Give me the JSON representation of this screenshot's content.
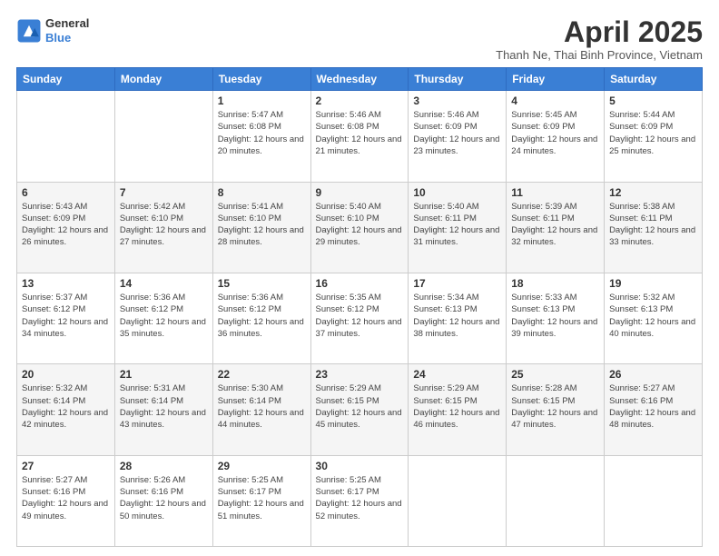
{
  "header": {
    "logo_line1": "General",
    "logo_line2": "Blue",
    "title": "April 2025",
    "subtitle": "Thanh Ne, Thai Binh Province, Vietnam"
  },
  "days_of_week": [
    "Sunday",
    "Monday",
    "Tuesday",
    "Wednesday",
    "Thursday",
    "Friday",
    "Saturday"
  ],
  "weeks": [
    [
      {
        "num": "",
        "sunrise": "",
        "sunset": "",
        "daylight": ""
      },
      {
        "num": "",
        "sunrise": "",
        "sunset": "",
        "daylight": ""
      },
      {
        "num": "1",
        "sunrise": "Sunrise: 5:47 AM",
        "sunset": "Sunset: 6:08 PM",
        "daylight": "Daylight: 12 hours and 20 minutes."
      },
      {
        "num": "2",
        "sunrise": "Sunrise: 5:46 AM",
        "sunset": "Sunset: 6:08 PM",
        "daylight": "Daylight: 12 hours and 21 minutes."
      },
      {
        "num": "3",
        "sunrise": "Sunrise: 5:46 AM",
        "sunset": "Sunset: 6:09 PM",
        "daylight": "Daylight: 12 hours and 23 minutes."
      },
      {
        "num": "4",
        "sunrise": "Sunrise: 5:45 AM",
        "sunset": "Sunset: 6:09 PM",
        "daylight": "Daylight: 12 hours and 24 minutes."
      },
      {
        "num": "5",
        "sunrise": "Sunrise: 5:44 AM",
        "sunset": "Sunset: 6:09 PM",
        "daylight": "Daylight: 12 hours and 25 minutes."
      }
    ],
    [
      {
        "num": "6",
        "sunrise": "Sunrise: 5:43 AM",
        "sunset": "Sunset: 6:09 PM",
        "daylight": "Daylight: 12 hours and 26 minutes."
      },
      {
        "num": "7",
        "sunrise": "Sunrise: 5:42 AM",
        "sunset": "Sunset: 6:10 PM",
        "daylight": "Daylight: 12 hours and 27 minutes."
      },
      {
        "num": "8",
        "sunrise": "Sunrise: 5:41 AM",
        "sunset": "Sunset: 6:10 PM",
        "daylight": "Daylight: 12 hours and 28 minutes."
      },
      {
        "num": "9",
        "sunrise": "Sunrise: 5:40 AM",
        "sunset": "Sunset: 6:10 PM",
        "daylight": "Daylight: 12 hours and 29 minutes."
      },
      {
        "num": "10",
        "sunrise": "Sunrise: 5:40 AM",
        "sunset": "Sunset: 6:11 PM",
        "daylight": "Daylight: 12 hours and 31 minutes."
      },
      {
        "num": "11",
        "sunrise": "Sunrise: 5:39 AM",
        "sunset": "Sunset: 6:11 PM",
        "daylight": "Daylight: 12 hours and 32 minutes."
      },
      {
        "num": "12",
        "sunrise": "Sunrise: 5:38 AM",
        "sunset": "Sunset: 6:11 PM",
        "daylight": "Daylight: 12 hours and 33 minutes."
      }
    ],
    [
      {
        "num": "13",
        "sunrise": "Sunrise: 5:37 AM",
        "sunset": "Sunset: 6:12 PM",
        "daylight": "Daylight: 12 hours and 34 minutes."
      },
      {
        "num": "14",
        "sunrise": "Sunrise: 5:36 AM",
        "sunset": "Sunset: 6:12 PM",
        "daylight": "Daylight: 12 hours and 35 minutes."
      },
      {
        "num": "15",
        "sunrise": "Sunrise: 5:36 AM",
        "sunset": "Sunset: 6:12 PM",
        "daylight": "Daylight: 12 hours and 36 minutes."
      },
      {
        "num": "16",
        "sunrise": "Sunrise: 5:35 AM",
        "sunset": "Sunset: 6:12 PM",
        "daylight": "Daylight: 12 hours and 37 minutes."
      },
      {
        "num": "17",
        "sunrise": "Sunrise: 5:34 AM",
        "sunset": "Sunset: 6:13 PM",
        "daylight": "Daylight: 12 hours and 38 minutes."
      },
      {
        "num": "18",
        "sunrise": "Sunrise: 5:33 AM",
        "sunset": "Sunset: 6:13 PM",
        "daylight": "Daylight: 12 hours and 39 minutes."
      },
      {
        "num": "19",
        "sunrise": "Sunrise: 5:32 AM",
        "sunset": "Sunset: 6:13 PM",
        "daylight": "Daylight: 12 hours and 40 minutes."
      }
    ],
    [
      {
        "num": "20",
        "sunrise": "Sunrise: 5:32 AM",
        "sunset": "Sunset: 6:14 PM",
        "daylight": "Daylight: 12 hours and 42 minutes."
      },
      {
        "num": "21",
        "sunrise": "Sunrise: 5:31 AM",
        "sunset": "Sunset: 6:14 PM",
        "daylight": "Daylight: 12 hours and 43 minutes."
      },
      {
        "num": "22",
        "sunrise": "Sunrise: 5:30 AM",
        "sunset": "Sunset: 6:14 PM",
        "daylight": "Daylight: 12 hours and 44 minutes."
      },
      {
        "num": "23",
        "sunrise": "Sunrise: 5:29 AM",
        "sunset": "Sunset: 6:15 PM",
        "daylight": "Daylight: 12 hours and 45 minutes."
      },
      {
        "num": "24",
        "sunrise": "Sunrise: 5:29 AM",
        "sunset": "Sunset: 6:15 PM",
        "daylight": "Daylight: 12 hours and 46 minutes."
      },
      {
        "num": "25",
        "sunrise": "Sunrise: 5:28 AM",
        "sunset": "Sunset: 6:15 PM",
        "daylight": "Daylight: 12 hours and 47 minutes."
      },
      {
        "num": "26",
        "sunrise": "Sunrise: 5:27 AM",
        "sunset": "Sunset: 6:16 PM",
        "daylight": "Daylight: 12 hours and 48 minutes."
      }
    ],
    [
      {
        "num": "27",
        "sunrise": "Sunrise: 5:27 AM",
        "sunset": "Sunset: 6:16 PM",
        "daylight": "Daylight: 12 hours and 49 minutes."
      },
      {
        "num": "28",
        "sunrise": "Sunrise: 5:26 AM",
        "sunset": "Sunset: 6:16 PM",
        "daylight": "Daylight: 12 hours and 50 minutes."
      },
      {
        "num": "29",
        "sunrise": "Sunrise: 5:25 AM",
        "sunset": "Sunset: 6:17 PM",
        "daylight": "Daylight: 12 hours and 51 minutes."
      },
      {
        "num": "30",
        "sunrise": "Sunrise: 5:25 AM",
        "sunset": "Sunset: 6:17 PM",
        "daylight": "Daylight: 12 hours and 52 minutes."
      },
      {
        "num": "",
        "sunrise": "",
        "sunset": "",
        "daylight": ""
      },
      {
        "num": "",
        "sunrise": "",
        "sunset": "",
        "daylight": ""
      },
      {
        "num": "",
        "sunrise": "",
        "sunset": "",
        "daylight": ""
      }
    ]
  ]
}
